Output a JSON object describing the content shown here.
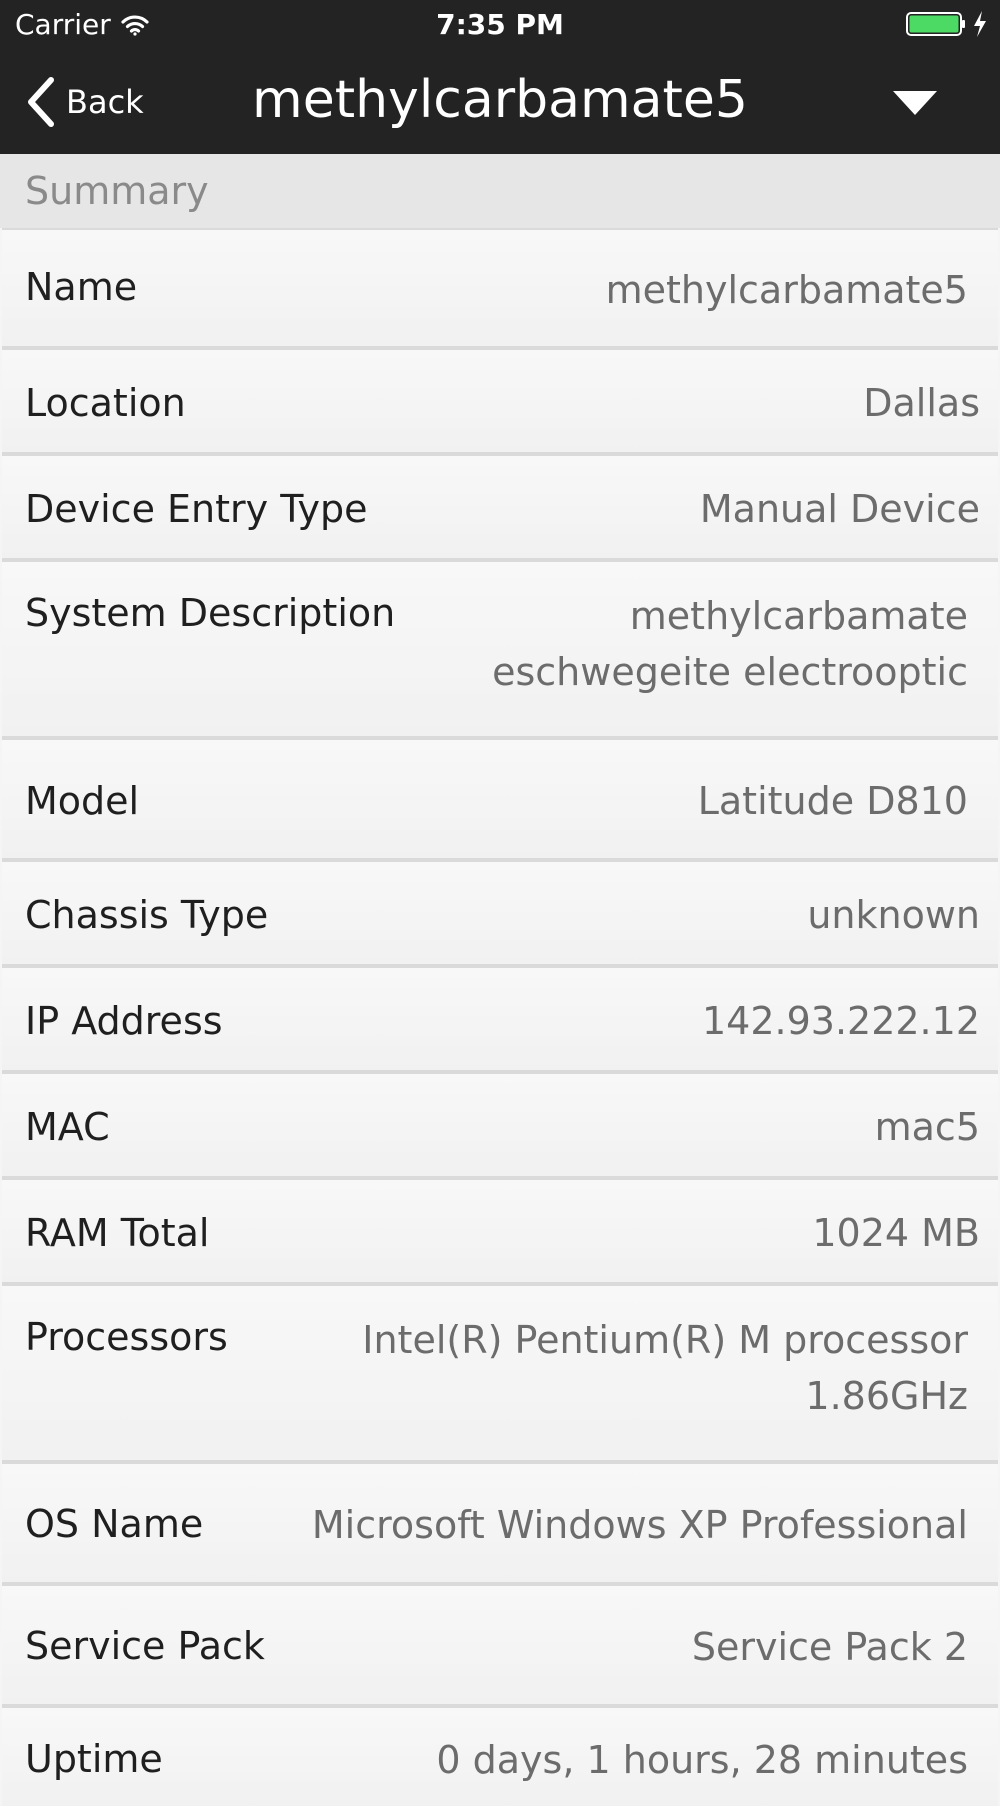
{
  "status_bar": {
    "carrier": "Carrier",
    "time": "7:35 PM",
    "battery_color": "#4cd964"
  },
  "nav": {
    "back_label": "Back",
    "title": "methylcarbamate5"
  },
  "section": {
    "title": "Summary"
  },
  "rows": [
    {
      "label": "Name",
      "value": "methylcarbamate5"
    },
    {
      "label": "Location",
      "value": "Dallas"
    },
    {
      "label": "Device Entry Type",
      "value": "Manual Device"
    },
    {
      "label": "System Description",
      "value": "methylcarbamate\neschwegeite electrooptic"
    },
    {
      "label": "Model",
      "value": "Latitude D810"
    },
    {
      "label": "Chassis Type",
      "value": "unknown"
    },
    {
      "label": "IP Address",
      "value": "142.93.222.12"
    },
    {
      "label": "MAC",
      "value": "mac5"
    },
    {
      "label": "RAM Total",
      "value": "1024 MB"
    },
    {
      "label": "Processors",
      "value": "Intel(R) Pentium(R) M processor\n1.86GHz"
    },
    {
      "label": "OS Name",
      "value": "Microsoft Windows XP Professional"
    },
    {
      "label": "Service Pack",
      "value": "Service Pack 2"
    },
    {
      "label": "Uptime",
      "value": "0 days, 1 hours, 28 minutes"
    }
  ]
}
